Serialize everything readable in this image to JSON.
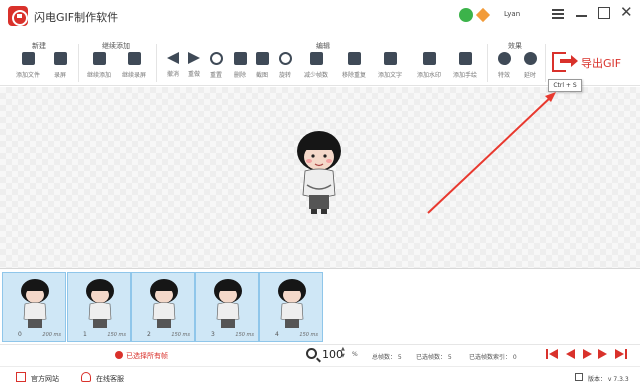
{
  "window": {
    "title": "闪电GIF制作软件",
    "username": "Lyan",
    "controls": [
      "menu-icon",
      "minimize-icon",
      "maximize-icon",
      "close-icon"
    ]
  },
  "toolbar": {
    "groups": {
      "new": "新建",
      "continue": "继续添加",
      "edit": "编辑",
      "effects": "效果"
    },
    "tools": {
      "add_file": "添加文件",
      "record": "录屏",
      "continue_add": "继续添加",
      "continue_record": "继续录屏",
      "undo": "撤消",
      "redo": "重做",
      "reset": "重置",
      "delete": "删除",
      "crop": "截图",
      "rotate": "旋转",
      "reduce_frames": "减少帧数",
      "remove_duplicates": "移除重复",
      "add_text": "添加文字",
      "add_watermark": "添加水印",
      "add_handwriting": "添加手绘",
      "effects": "特效",
      "delay": "延时"
    },
    "export_label": "导出GIF",
    "export_tooltip": "Ctrl + S"
  },
  "timeline": {
    "frames": [
      {
        "index": "0",
        "duration": "200 ms"
      },
      {
        "index": "1",
        "duration": "150 ms"
      },
      {
        "index": "2",
        "duration": "150 ms"
      },
      {
        "index": "3",
        "duration": "150 ms"
      },
      {
        "index": "4",
        "duration": "150 ms"
      }
    ]
  },
  "status": {
    "selected_all": "已选择所有帧",
    "zoom_value": "100",
    "zoom_up": "▲",
    "zoom_down": "▼",
    "zoom_unit": "%",
    "total_frames": "总帧数： 5",
    "selected_frames": "已选帧数： 5",
    "selected_index": "已选帧数索引： 0"
  },
  "footer": {
    "website": "官方网站",
    "support": "在线客服",
    "version": "版本： v 7.3.3"
  },
  "colors": {
    "accent": "#d9312b",
    "frame_bg": "#cfe7f6",
    "frame_border": "#8fc6ea"
  }
}
